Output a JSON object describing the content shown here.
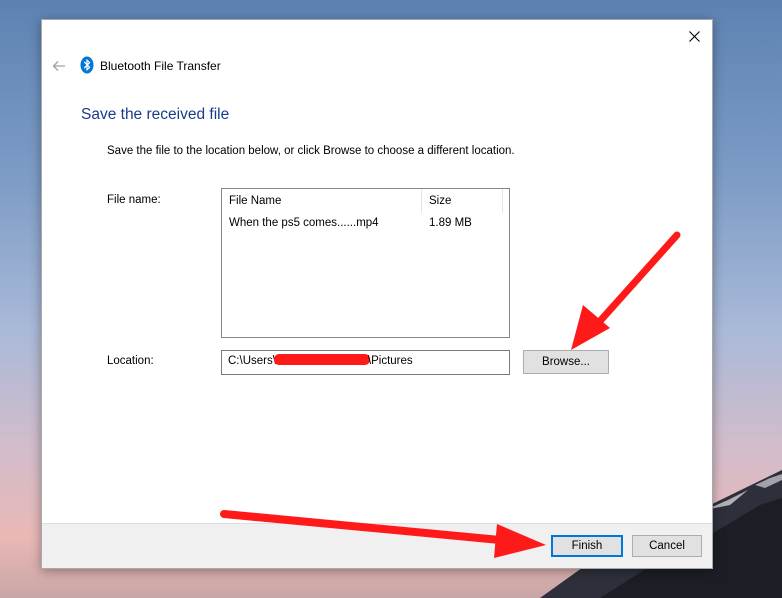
{
  "window": {
    "app_title": "Bluetooth File Transfer",
    "heading": "Save the received file",
    "instructions": "Save the file to the location below, or click Browse to choose a different location."
  },
  "form": {
    "file_name_label": "File name:",
    "location_label": "Location:",
    "location_prefix": "C:\\Users\\",
    "location_suffix": "\\Pictures",
    "browse_label": "Browse..."
  },
  "file_list": {
    "columns": [
      "File Name",
      "Size"
    ],
    "rows": [
      {
        "name": "When the ps5 comes......mp4",
        "size": "1.89 MB"
      }
    ]
  },
  "footer": {
    "finish_label": "Finish",
    "cancel_label": "Cancel"
  },
  "colors": {
    "heading": "#1a3b8c",
    "bluetooth": "#0078d7",
    "annotation_arrow": "#ff1a1a"
  },
  "icons": {
    "close": "close-icon",
    "back": "back-arrow-icon",
    "app": "bluetooth-icon"
  }
}
